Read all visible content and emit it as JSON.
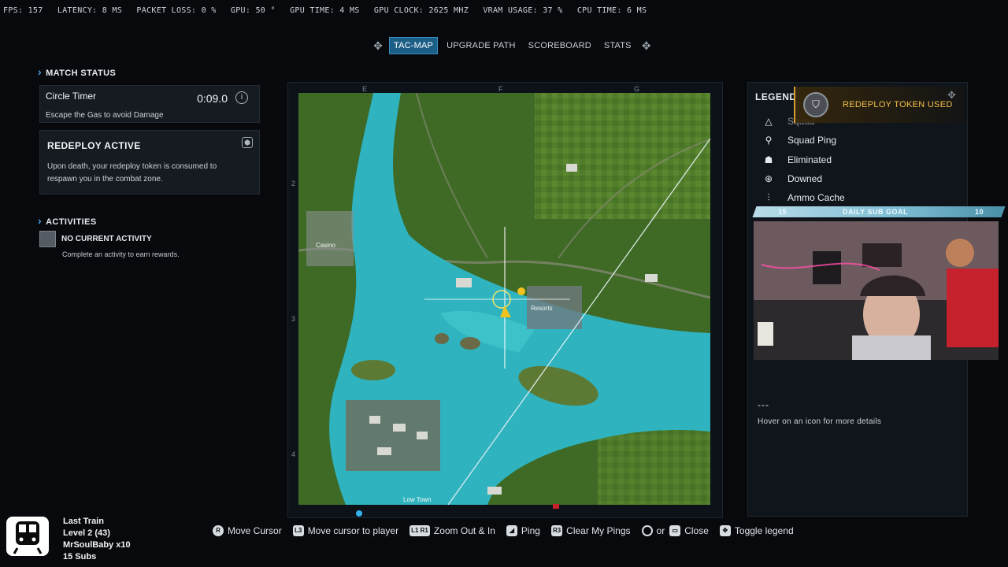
{
  "perf": {
    "fps": "FPS: 157",
    "latency": "LATENCY: 8 MS",
    "packet_loss": "PACKET LOSS: 0 %",
    "gpu": "GPU: 50 °",
    "gpu_time": "GPU TIME: 4 MS",
    "gpu_clock": "GPU CLOCK: 2625 MHZ",
    "vram": "VRAM USAGE: 37 %",
    "cpu_time": "CPU TIME: 6 MS"
  },
  "tabs": [
    {
      "label": "TAC-MAP",
      "active": true
    },
    {
      "label": "UPGRADE PATH",
      "active": false
    },
    {
      "label": "SCOREBOARD",
      "active": false
    },
    {
      "label": "STATS",
      "active": false
    }
  ],
  "match_status": {
    "heading": "MATCH STATUS",
    "timer_title": "Circle Timer",
    "timer_value": "0:09.0",
    "timer_sub": "Escape the Gas to avoid Damage",
    "redeploy_title": "REDEPLOY ACTIVE",
    "redeploy_desc": "Upon death, your redeploy token is consumed to respawn you in the combat zone."
  },
  "activities": {
    "heading": "ACTIVITIES",
    "title": "NO CURRENT ACTIVITY",
    "sub": "Complete an activity to earn rewards."
  },
  "map": {
    "col_labels": [
      "E",
      "F",
      "G"
    ],
    "row_labels": [
      "2",
      "3",
      "4"
    ],
    "places": {
      "casino": "Casino",
      "resorts": "Resorts",
      "low_town": "Low Town"
    }
  },
  "legend": {
    "title": "LEGEND",
    "items": [
      {
        "label": "Squad",
        "icon": "triangle-icon"
      },
      {
        "label": "Squad Ping",
        "icon": "pin-icon"
      },
      {
        "label": "Eliminated",
        "icon": "skull-icon"
      },
      {
        "label": "Downed",
        "icon": "downed-icon"
      },
      {
        "label": "Ammo Cache",
        "icon": "ammo-icon"
      }
    ],
    "hover_dash": "---",
    "hover_text": "Hover on an icon for more details"
  },
  "token_banner": {
    "text": "REDEPLOY TOKEN USED"
  },
  "sub_goal": {
    "left": "15",
    "label": "DAILY SUB GOAL",
    "right": "10"
  },
  "hints": [
    {
      "glyph": "R",
      "label": "Move Cursor"
    },
    {
      "glyph": "L3",
      "label": "Move cursor to player"
    },
    {
      "glyph": "L1 R1",
      "label": "Zoom Out & In"
    },
    {
      "glyph": "",
      "label": "Ping"
    },
    {
      "glyph": "R3",
      "label": "Clear My Pings"
    },
    {
      "glyph": "",
      "label": "Close"
    },
    {
      "glyph": "",
      "label": "Toggle legend"
    }
  ],
  "hint_or": "or",
  "stream_alert": {
    "line1": "Last Train",
    "line2": "Level 2  (43)",
    "line3": "MrSoulBaby x10",
    "line4": "15 Subs"
  },
  "colors": {
    "accent": "#1c5f86",
    "gold": "#f4c04a",
    "water": "#2fb3bf"
  }
}
